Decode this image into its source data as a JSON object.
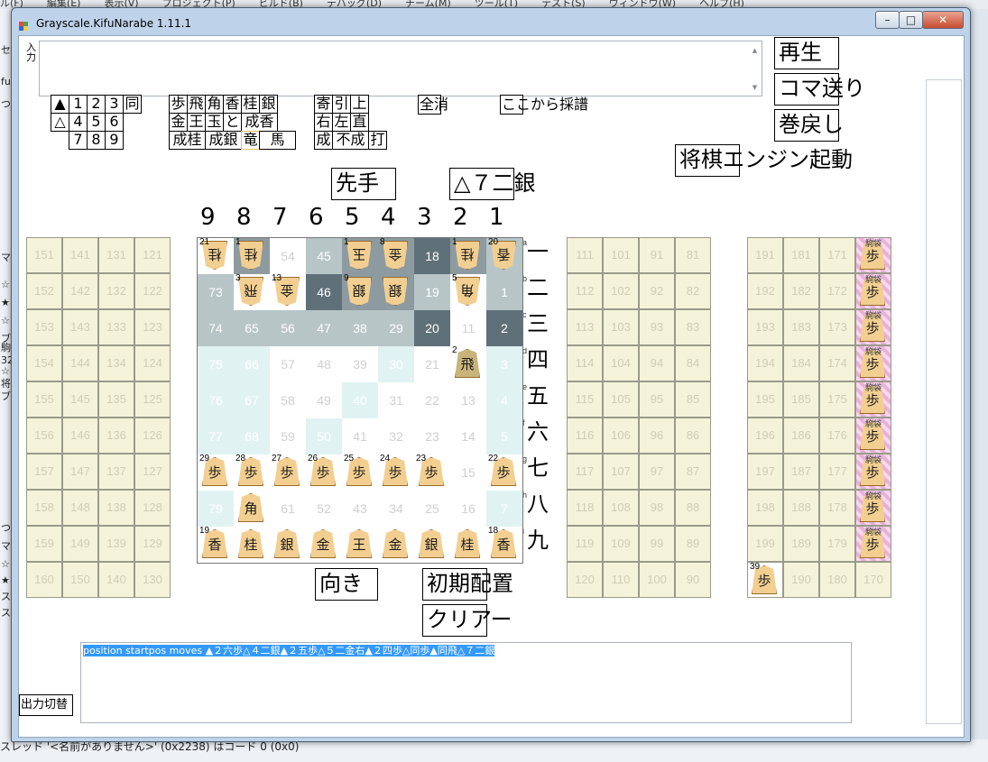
{
  "background": {
    "menu": [
      "ル(F)",
      "編集(E)",
      "表示(V)",
      "プロジェクト(P)",
      "ビルド(B)",
      "デバッグ(D)",
      "チーム(M)",
      "ツール(T)",
      "テスト(S)",
      "ウィンドウ(W)",
      "ヘルプ(H)"
    ],
    "left_chars": [
      "セ",
      "fu",
      "つ",
      "マ",
      "☆",
      "★",
      "☆",
      "ブ",
      "駒",
      "32",
      "☆",
      "将",
      "ブ",
      "つ",
      "マ",
      "☆",
      "★",
      "ス",
      "ス"
    ],
    "status": "スレッド '<名前がありません>' (0x2238) はコード 0 (0x0)"
  },
  "window": {
    "title": "Grayscale.KifuNarabe 1.11.1",
    "minimize": "–",
    "maximize": "□",
    "close": "✕"
  },
  "input": {
    "label": "入力",
    "value": ""
  },
  "keypad": {
    "rows": [
      [
        "▲",
        "1",
        "2",
        "3",
        "同"
      ],
      [
        "△",
        "4",
        "5",
        "6"
      ],
      [
        "7",
        "8",
        "9"
      ]
    ]
  },
  "pieces_pad": {
    "row1": [
      "歩",
      "飛",
      "角",
      "香",
      "桂",
      "銀"
    ],
    "row2": [
      "金",
      "王",
      "玉",
      "と",
      "成香"
    ],
    "row3": [
      "成桂",
      "成銀",
      "竜",
      "馬"
    ]
  },
  "modifiers": {
    "row1": [
      "寄",
      "引",
      "上"
    ],
    "row2": [
      "右",
      "左",
      "直"
    ],
    "row3": [
      "成",
      "不成",
      "打"
    ]
  },
  "buttons": {
    "clear_all": "全消",
    "record_from_here": "ここから採譜",
    "play": "再生",
    "step_forward": "コマ送り",
    "step_back": "巻戻し",
    "engine_start": "将棋エンジン起動",
    "turn": "先手",
    "last_move": "△７二銀",
    "orientation": "向き",
    "initial_setup": "初期配置",
    "clear": "クリアー",
    "output_switch": "出力切替"
  },
  "board": {
    "col_labels": [
      "9",
      "8",
      "7",
      "6",
      "5",
      "4",
      "3",
      "2",
      "1"
    ],
    "row_labels": [
      "一",
      "二",
      "三",
      "四",
      "五",
      "六",
      "七",
      "八",
      "九"
    ],
    "row_letters": [
      "a",
      "b",
      "c",
      "d",
      "e",
      "f",
      "g",
      "h",
      "i"
    ],
    "squares": [
      [
        {
          "n": "21",
          "p": "桂",
          "o": "g"
        },
        {
          "n": "1",
          "p": "桂",
          "o": "g"
        },
        {
          "n": "54"
        },
        {
          "n": "45"
        },
        {
          "n": "1",
          "p": "玉",
          "o": "g"
        },
        {
          "n": "8",
          "p": "金",
          "o": "g"
        },
        {
          "n": "18"
        },
        {
          "n": "1",
          "p": "桂",
          "o": "g"
        },
        {
          "n": "20",
          "p": "香",
          "o": "g"
        }
      ],
      [
        {
          "n": "73"
        },
        {
          "n": "3",
          "p": "飛",
          "o": "g"
        },
        {
          "n": "13",
          "p": "金",
          "o": "g"
        },
        {
          "n": "46"
        },
        {
          "n": "9",
          "p": "銀",
          "o": "g"
        },
        {
          "n": "",
          "p": "銀",
          "o": "g"
        },
        {
          "n": "19"
        },
        {
          "n": "5",
          "p": "角",
          "o": "g"
        },
        {
          "n": "1"
        }
      ],
      [
        {
          "n": "74"
        },
        {
          "n": "65"
        },
        {
          "n": "56"
        },
        {
          "n": "47"
        },
        {
          "n": "38"
        },
        {
          "n": "29"
        },
        {
          "n": "20"
        },
        {
          "n": "11"
        },
        {
          "n": "2"
        }
      ],
      [
        {
          "n": "75"
        },
        {
          "n": "66"
        },
        {
          "n": "57"
        },
        {
          "n": "48"
        },
        {
          "n": "39"
        },
        {
          "n": "30"
        },
        {
          "n": "21"
        },
        {
          "n": "2",
          "p": "飛"
        },
        {
          "n": "3"
        }
      ],
      [
        {
          "n": "76"
        },
        {
          "n": "67"
        },
        {
          "n": "58"
        },
        {
          "n": "49"
        },
        {
          "n": "40"
        },
        {
          "n": "31"
        },
        {
          "n": "22"
        },
        {
          "n": "13"
        },
        {
          "n": "4"
        }
      ],
      [
        {
          "n": "77"
        },
        {
          "n": "68"
        },
        {
          "n": "59"
        },
        {
          "n": "50"
        },
        {
          "n": "41"
        },
        {
          "n": "32"
        },
        {
          "n": "23"
        },
        {
          "n": "14"
        },
        {
          "n": "5"
        }
      ],
      [
        {
          "n": "29",
          "p": "歩"
        },
        {
          "n": "28",
          "p": "歩"
        },
        {
          "n": "27",
          "p": "歩"
        },
        {
          "n": "26",
          "p": "歩"
        },
        {
          "n": "25",
          "p": "歩"
        },
        {
          "n": "24",
          "p": "歩"
        },
        {
          "n": "23",
          "p": "歩"
        },
        {
          "n": "15"
        },
        {
          "n": "22",
          "p": "歩"
        }
      ],
      [
        {
          "n": "79"
        },
        {
          "n": "",
          "p": "角"
        },
        {
          "n": "61"
        },
        {
          "n": "52"
        },
        {
          "n": "43"
        },
        {
          "n": "34"
        },
        {
          "n": "25"
        },
        {
          "n": "16"
        },
        {
          "n": "7"
        }
      ],
      [
        {
          "n": "19",
          "p": "香"
        },
        {
          "n": "",
          "p": "桂"
        },
        {
          "n": "",
          "p": "銀"
        },
        {
          "n": "",
          "p": "金"
        },
        {
          "n": "",
          "p": "王"
        },
        {
          "n": "",
          "p": "金"
        },
        {
          "n": "",
          "p": "銀"
        },
        {
          "n": "",
          "p": "桂"
        },
        {
          "n": "18",
          "p": "香"
        }
      ]
    ],
    "shade": [
      [
        "w",
        "d",
        "w",
        "m",
        "d",
        "d",
        "D",
        "d",
        "m"
      ],
      [
        "m",
        "w",
        "w",
        "D",
        "d",
        "d",
        "m",
        "w",
        "m"
      ],
      [
        "m",
        "m",
        "m",
        "m",
        "m",
        "m",
        "D",
        "w",
        "D"
      ],
      [
        "l",
        "l",
        "w",
        "w",
        "w",
        "l",
        "w",
        "w",
        "l"
      ],
      [
        "l",
        "l",
        "w",
        "w",
        "l",
        "w",
        "w",
        "w",
        "l"
      ],
      [
        "l",
        "l",
        "w",
        "l",
        "w",
        "w",
        "w",
        "w",
        "l"
      ],
      [
        "w",
        "w",
        "w",
        "w",
        "w",
        "w",
        "w",
        "w",
        "w"
      ],
      [
        "l",
        "w",
        "w",
        "w",
        "w",
        "w",
        "w",
        "w",
        "l"
      ],
      [
        "w",
        "w",
        "w",
        "w",
        "w",
        "w",
        "w",
        "w",
        "w"
      ]
    ]
  },
  "left_hand": [
    [
      "151",
      "141",
      "131",
      "121"
    ],
    [
      "152",
      "142",
      "132",
      "122"
    ],
    [
      "153",
      "143",
      "133",
      "123"
    ],
    [
      "154",
      "144",
      "134",
      "124"
    ],
    [
      "155",
      "145",
      "135",
      "125"
    ],
    [
      "156",
      "146",
      "136",
      "126"
    ],
    [
      "157",
      "147",
      "137",
      "127"
    ],
    [
      "158",
      "148",
      "138",
      "128"
    ],
    [
      "159",
      "149",
      "139",
      "129"
    ],
    [
      "160",
      "150",
      "140",
      "130"
    ]
  ],
  "right_hand": [
    [
      "111",
      "101",
      "91",
      "81"
    ],
    [
      "112",
      "102",
      "92",
      "82"
    ],
    [
      "113",
      "103",
      "93",
      "83"
    ],
    [
      "114",
      "104",
      "94",
      "84"
    ],
    [
      "115",
      "105",
      "95",
      "85"
    ],
    [
      "116",
      "106",
      "96",
      "86"
    ],
    [
      "117",
      "107",
      "97",
      "87"
    ],
    [
      "118",
      "108",
      "98",
      "88"
    ],
    [
      "119",
      "109",
      "99",
      "89"
    ],
    [
      "120",
      "110",
      "100",
      "90"
    ]
  ],
  "box_hand": [
    [
      "191",
      "181",
      "171",
      "駒袋"
    ],
    [
      "192",
      "182",
      "172",
      "駒袋"
    ],
    [
      "193",
      "183",
      "173",
      "駒袋"
    ],
    [
      "194",
      "184",
      "174",
      "駒袋"
    ],
    [
      "195",
      "185",
      "175",
      "駒袋"
    ],
    [
      "196",
      "186",
      "176",
      "駒袋"
    ],
    [
      "197",
      "187",
      "177",
      "駒袋"
    ],
    [
      "198",
      "188",
      "178",
      "駒袋"
    ],
    [
      "199",
      "189",
      "179",
      "駒袋"
    ],
    [
      "39",
      "190",
      "180",
      "170"
    ]
  ],
  "box_piece_label": "歩",
  "output": {
    "text": "position startpos moves ▲２六歩△４二銀▲２五歩△５二金右▲２四歩△同歩▲同飛△７二銀"
  }
}
